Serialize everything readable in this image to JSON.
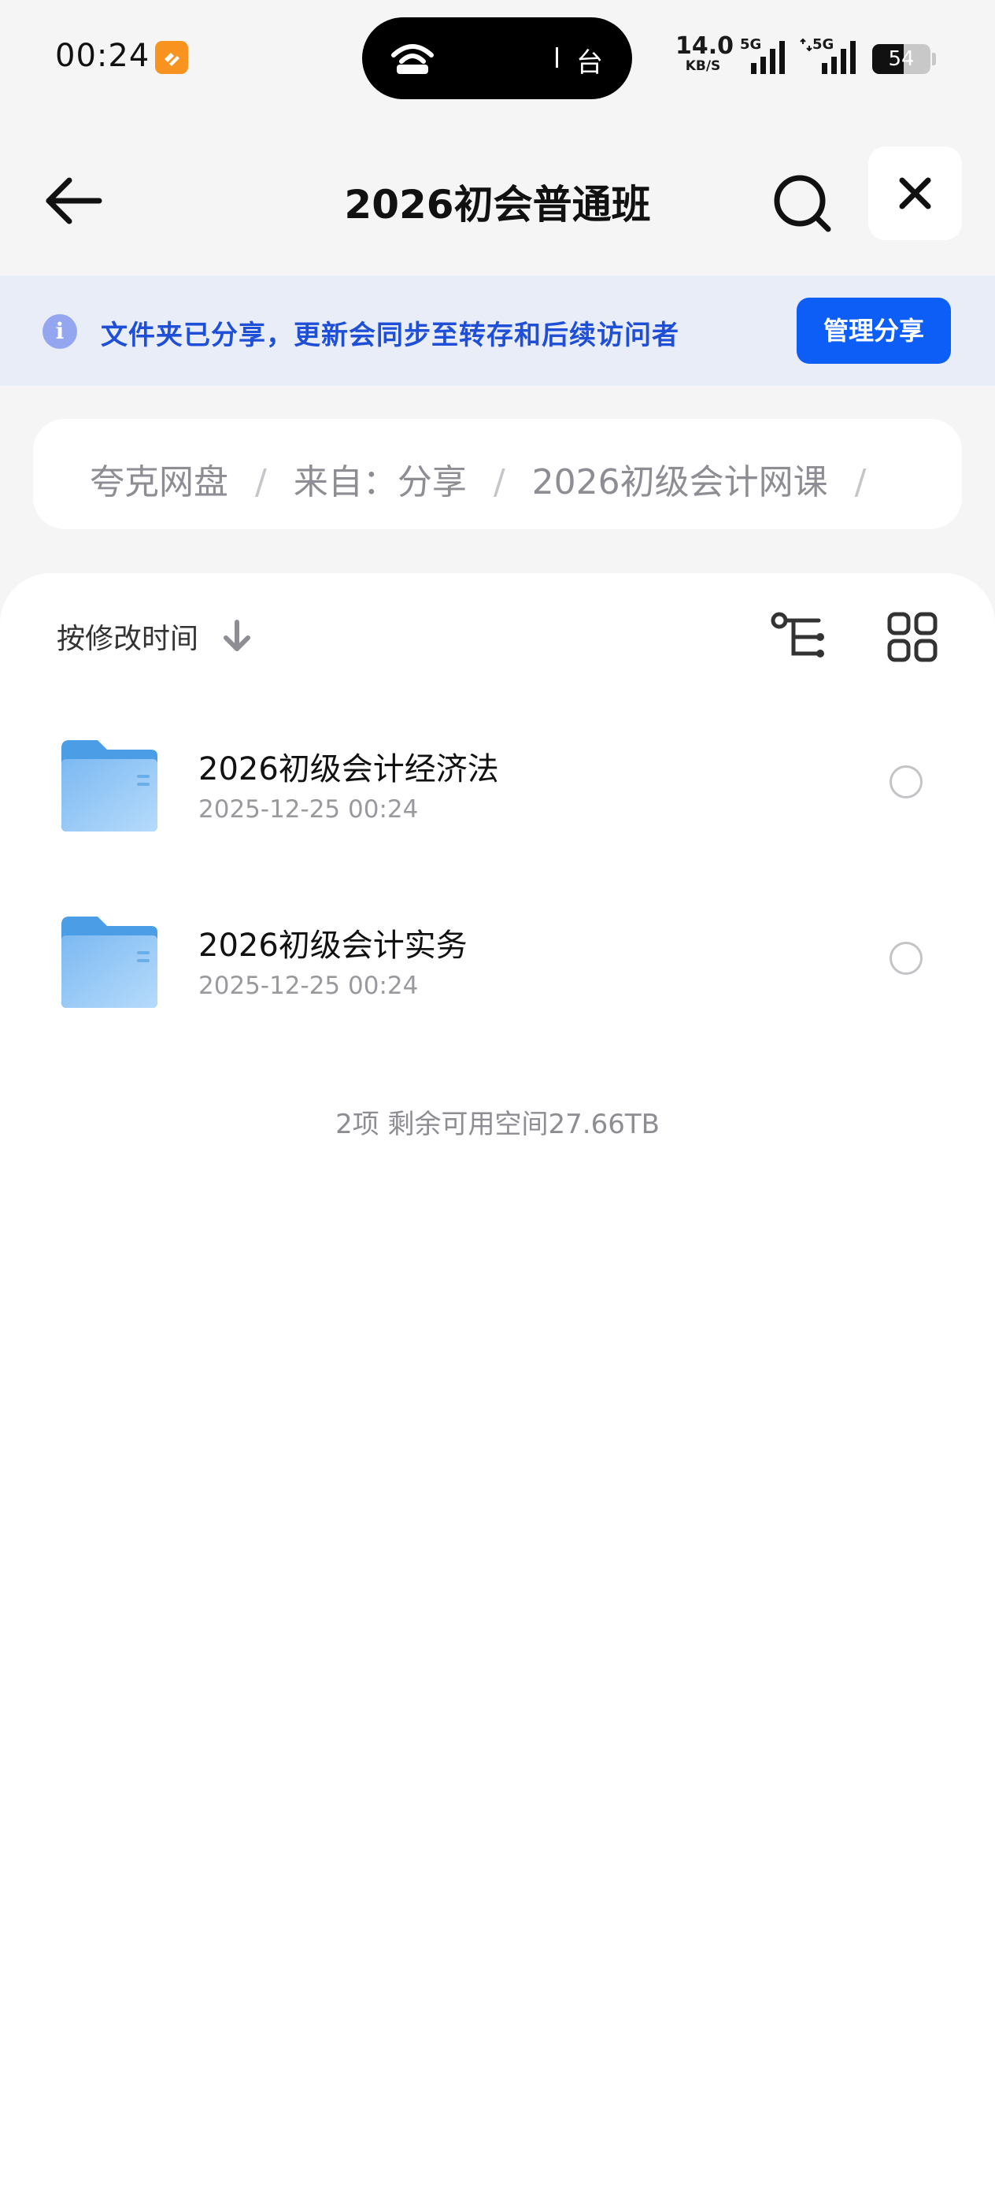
{
  "status_bar": {
    "time": "00:24",
    "island_text": "台",
    "net_speed_value": "14.0",
    "net_speed_unit": "KB/S",
    "signal_1_label": "5G",
    "signal_2_label": "5G",
    "battery_level": "54",
    "battery_fraction": 0.54
  },
  "header": {
    "title": "2026初会普通班"
  },
  "share_banner": {
    "message": "文件夹已分享，更新会同步至转存和后续访问者",
    "manage_label": "管理分享"
  },
  "breadcrumb": {
    "items": [
      "夸克网盘",
      "来自：分享",
      "2026初级会计网课"
    ],
    "separator": "/"
  },
  "toolbar": {
    "sort_label": "按修改时间"
  },
  "files": [
    {
      "name": "2026初级会计经济法",
      "date": "2025-12-25 00:24"
    },
    {
      "name": "2026初级会计实务",
      "date": "2025-12-25 00:24"
    }
  ],
  "summary": "2项 剩余可用空间27.66TB",
  "colors": {
    "accent": "#0d5ef7",
    "banner_text": "#1f4fd6",
    "banner_bg": "#e9edf8",
    "folder": "#5aa9ec"
  },
  "icons": {
    "back": "arrow-left-icon",
    "search": "search-icon",
    "close": "close-icon",
    "info": "info-icon",
    "sort": "arrow-down-icon",
    "tree": "tree-view-icon",
    "grid": "grid-view-icon",
    "folder": "folder-icon"
  }
}
